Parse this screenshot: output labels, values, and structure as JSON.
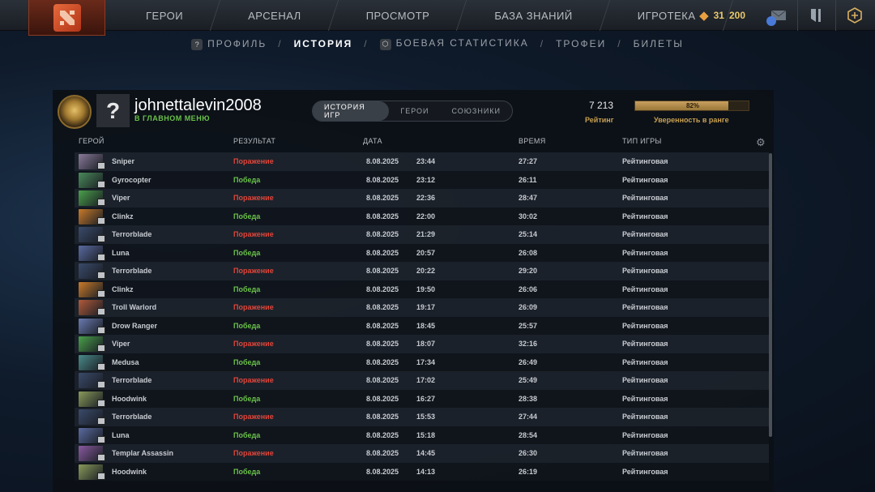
{
  "topnav": {
    "items": [
      "ГЕРОИ",
      "АРСЕНАЛ",
      "ПРОСМОТР",
      "БАЗА ЗНАНИЙ",
      "ИГРОТЕКА"
    ],
    "battlepass_level": "31",
    "battlepass_points": "200"
  },
  "subnav": {
    "items": [
      "ПРОФИЛЬ",
      "ИСТОРИЯ",
      "БОЕВАЯ СТАТИСТИКА",
      "ТРОФЕИ",
      "БИЛЕТЫ"
    ],
    "active": "ИСТОРИЯ",
    "separator": "/"
  },
  "profile": {
    "username": "johnettalevin2008",
    "status": "В ГЛАВНОМ МЕНЮ",
    "avatar_glyph": "?",
    "tabs": [
      "ИСТОРИЯ ИГР",
      "ГЕРОИ",
      "СОЮЗНИКИ"
    ],
    "active_tab": "ИСТОРИЯ ИГР",
    "rating": "7 213",
    "rating_label": "Рейтинг",
    "confidence_pct": "82%",
    "confidence_value": 0.82,
    "confidence_label": "Уверенность в ранге"
  },
  "table": {
    "headers": {
      "hero": "ГЕРОЙ",
      "result": "РЕЗУЛЬТАТ",
      "date": "ДАТА",
      "duration": "ВРЕМЯ",
      "type": "ТИП ИГРЫ"
    },
    "rows": [
      {
        "hero": "Sniper",
        "result": "Поражение",
        "outcome": "loss",
        "date": "8.08.2025",
        "time": "23:44",
        "duration": "27:27",
        "type": "Рейтинговая",
        "color": "#8a7a9a"
      },
      {
        "hero": "Gyrocopter",
        "result": "Победа",
        "outcome": "win",
        "date": "8.08.2025",
        "time": "23:12",
        "duration": "26:11",
        "type": "Рейтинговая",
        "color": "#4a8a5a"
      },
      {
        "hero": "Viper",
        "result": "Поражение",
        "outcome": "loss",
        "date": "8.08.2025",
        "time": "22:36",
        "duration": "28:47",
        "type": "Рейтинговая",
        "color": "#4aa04a"
      },
      {
        "hero": "Clinkz",
        "result": "Победа",
        "outcome": "win",
        "date": "8.08.2025",
        "time": "22:00",
        "duration": "30:02",
        "type": "Рейтинговая",
        "color": "#c87a2a"
      },
      {
        "hero": "Terrorblade",
        "result": "Поражение",
        "outcome": "loss",
        "date": "8.08.2025",
        "time": "21:29",
        "duration": "25:14",
        "type": "Рейтинговая",
        "color": "#3a4a6a"
      },
      {
        "hero": "Luna",
        "result": "Победа",
        "outcome": "win",
        "date": "8.08.2025",
        "time": "20:57",
        "duration": "26:08",
        "type": "Рейтинговая",
        "color": "#5a6aa0"
      },
      {
        "hero": "Terrorblade",
        "result": "Поражение",
        "outcome": "loss",
        "date": "8.08.2025",
        "time": "20:22",
        "duration": "29:20",
        "type": "Рейтинговая",
        "color": "#3a4a6a"
      },
      {
        "hero": "Clinkz",
        "result": "Победа",
        "outcome": "win",
        "date": "8.08.2025",
        "time": "19:50",
        "duration": "26:06",
        "type": "Рейтинговая",
        "color": "#c87a2a"
      },
      {
        "hero": "Troll Warlord",
        "result": "Поражение",
        "outcome": "loss",
        "date": "8.08.2025",
        "time": "19:17",
        "duration": "26:09",
        "type": "Рейтинговая",
        "color": "#b05a3a"
      },
      {
        "hero": "Drow Ranger",
        "result": "Победа",
        "outcome": "win",
        "date": "8.08.2025",
        "time": "18:45",
        "duration": "25:57",
        "type": "Рейтинговая",
        "color": "#6a7ab0"
      },
      {
        "hero": "Viper",
        "result": "Поражение",
        "outcome": "loss",
        "date": "8.08.2025",
        "time": "18:07",
        "duration": "32:16",
        "type": "Рейтинговая",
        "color": "#4aa04a"
      },
      {
        "hero": "Medusa",
        "result": "Победа",
        "outcome": "win",
        "date": "8.08.2025",
        "time": "17:34",
        "duration": "26:49",
        "type": "Рейтинговая",
        "color": "#4a8a8a"
      },
      {
        "hero": "Terrorblade",
        "result": "Поражение",
        "outcome": "loss",
        "date": "8.08.2025",
        "time": "17:02",
        "duration": "25:49",
        "type": "Рейтинговая",
        "color": "#3a4a6a"
      },
      {
        "hero": "Hoodwink",
        "result": "Победа",
        "outcome": "win",
        "date": "8.08.2025",
        "time": "16:27",
        "duration": "28:38",
        "type": "Рейтинговая",
        "color": "#8a9a5a"
      },
      {
        "hero": "Terrorblade",
        "result": "Поражение",
        "outcome": "loss",
        "date": "8.08.2025",
        "time": "15:53",
        "duration": "27:44",
        "type": "Рейтинговая",
        "color": "#3a4a6a"
      },
      {
        "hero": "Luna",
        "result": "Победа",
        "outcome": "win",
        "date": "8.08.2025",
        "time": "15:18",
        "duration": "28:54",
        "type": "Рейтинговая",
        "color": "#5a6aa0"
      },
      {
        "hero": "Templar Assassin",
        "result": "Поражение",
        "outcome": "loss",
        "date": "8.08.2025",
        "time": "14:45",
        "duration": "26:30",
        "type": "Рейтинговая",
        "color": "#8a5aa0"
      },
      {
        "hero": "Hoodwink",
        "result": "Победа",
        "outcome": "win",
        "date": "8.08.2025",
        "time": "14:13",
        "duration": "26:19",
        "type": "Рейтинговая",
        "color": "#8a9a5a"
      }
    ]
  },
  "colors": {
    "win": "#6ac24a",
    "loss": "#e0453a",
    "gold": "#c8a050"
  }
}
